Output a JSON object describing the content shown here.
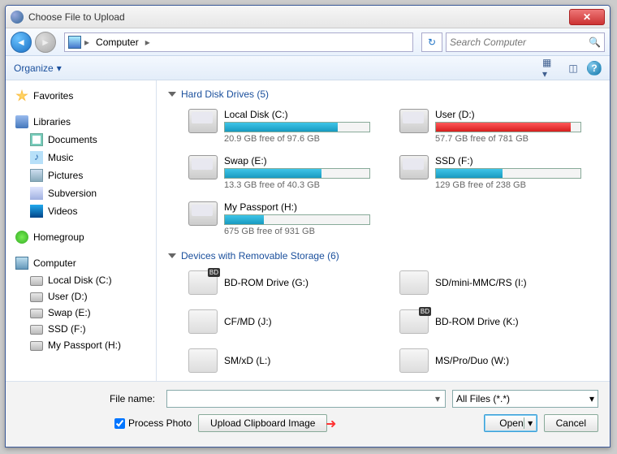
{
  "window": {
    "title": "Choose File to Upload"
  },
  "nav": {
    "breadcrumb_root_icon": "computer",
    "breadcrumb_label": "Computer",
    "search_placeholder": "Search Computer"
  },
  "toolbar": {
    "organize": "Organize"
  },
  "sidebar": {
    "favorites": "Favorites",
    "libraries": "Libraries",
    "lib_items": [
      {
        "label": "Documents"
      },
      {
        "label": "Music"
      },
      {
        "label": "Pictures"
      },
      {
        "label": "Subversion"
      },
      {
        "label": "Videos"
      }
    ],
    "homegroup": "Homegroup",
    "computer": "Computer",
    "drives": [
      {
        "label": "Local Disk (C:)"
      },
      {
        "label": "User (D:)"
      },
      {
        "label": "Swap (E:)"
      },
      {
        "label": "SSD (F:)"
      },
      {
        "label": "My Passport (H:)"
      }
    ]
  },
  "content": {
    "hdd_header": "Hard Disk Drives (5)",
    "removable_header": "Devices with Removable Storage (6)",
    "hdd": [
      {
        "name": "Local Disk (C:)",
        "free": "20.9 GB free of 97.6 GB",
        "pct": 78,
        "color": "blue"
      },
      {
        "name": "User (D:)",
        "free": "57.7 GB free of 781 GB",
        "pct": 93,
        "color": "red"
      },
      {
        "name": "Swap (E:)",
        "free": "13.3 GB free of 40.3 GB",
        "pct": 67,
        "color": "blue"
      },
      {
        "name": "SSD (F:)",
        "free": "129 GB free of 238 GB",
        "pct": 46,
        "color": "blue"
      },
      {
        "name": "My Passport (H:)",
        "free": "675 GB free of 931 GB",
        "pct": 27,
        "color": "blue"
      }
    ],
    "removable": [
      {
        "name": "BD-ROM Drive (G:)",
        "bd": true
      },
      {
        "name": "SD/mini-MMC/RS (I:)",
        "bd": false
      },
      {
        "name": "CF/MD (J:)",
        "bd": false
      },
      {
        "name": "BD-ROM Drive (K:)",
        "bd": true
      },
      {
        "name": "SM/xD (L:)",
        "bd": false
      },
      {
        "name": "MS/Pro/Duo (W:)",
        "bd": false
      }
    ]
  },
  "footer": {
    "filename_label": "File name:",
    "filter_label": "All Files (*.*)",
    "process_photo": "Process Photo",
    "upload_clipboard": "Upload Clipboard Image",
    "open": "Open",
    "cancel": "Cancel"
  }
}
